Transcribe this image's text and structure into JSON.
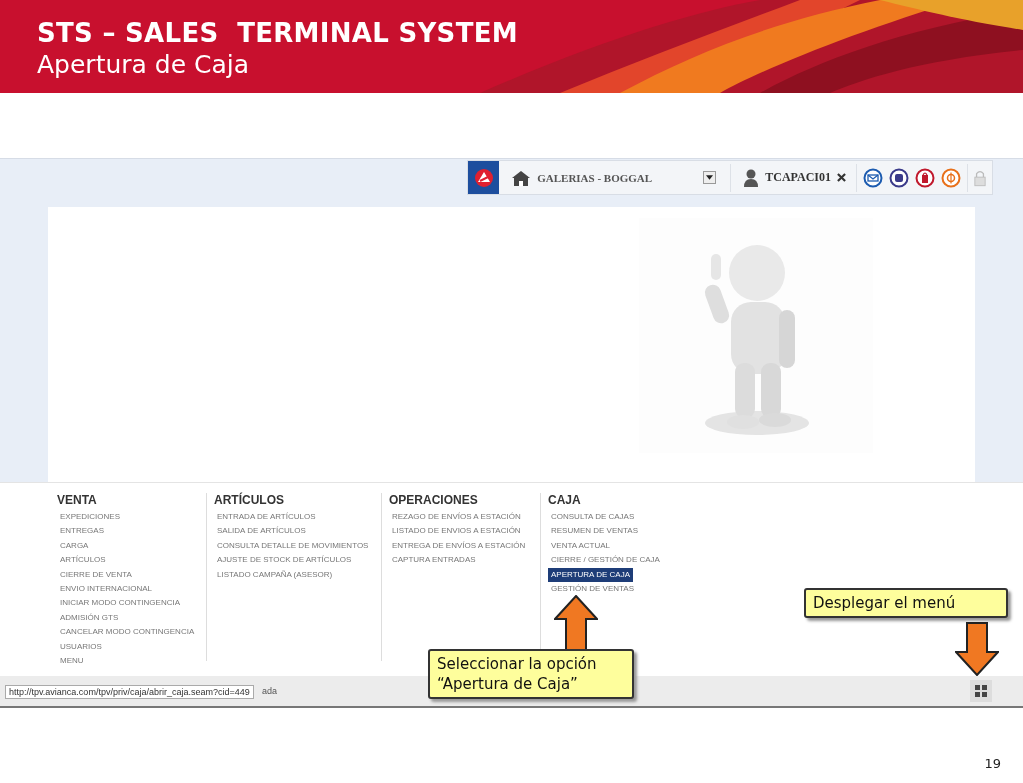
{
  "slide": {
    "title": "STS – SALES  TERMINAL SYSTEM",
    "subtitle": "Apertura de Caja",
    "page_number": "19"
  },
  "toolbar": {
    "store": "GALERIAS - BOGGAL",
    "user": "TCAPACI01"
  },
  "menu": [
    {
      "heading": "VENTA",
      "items": [
        {
          "label": "EXPEDICIONES",
          "selected": false
        },
        {
          "label": "ENTREGAS",
          "selected": false
        },
        {
          "label": "CARGA",
          "selected": false
        },
        {
          "label": "ARTÍCULOS",
          "selected": false
        },
        {
          "label": "CIERRE DE VENTA",
          "selected": false
        },
        {
          "label": "ENVIO INTERNACIONAL",
          "selected": false
        },
        {
          "label": "INICIAR MODO CONTINGENCIA",
          "selected": false
        },
        {
          "label": "ADMISIÓN GTS",
          "selected": false
        },
        {
          "label": "CANCELAR MODO CONTINGENCIA",
          "selected": false
        },
        {
          "label": "USUARIOS",
          "selected": false
        },
        {
          "label": "MENU",
          "selected": false
        }
      ]
    },
    {
      "heading": "ARTÍCULOS",
      "items": [
        {
          "label": "ENTRADA DE ARTÍCULOS",
          "selected": false
        },
        {
          "label": "SALIDA DE ARTÍCULOS",
          "selected": false
        },
        {
          "label": "CONSULTA DETALLE DE MOVIMIENTOS",
          "selected": false
        },
        {
          "label": "AJUSTE DE STOCK DE ARTÍCULOS",
          "selected": false
        },
        {
          "label": "LISTADO CAMPAÑA (ASESOR)",
          "selected": false
        }
      ]
    },
    {
      "heading": "OPERACIONES",
      "items": [
        {
          "label": "REZAGO DE ENVÍOS A ESTACIÓN",
          "selected": false
        },
        {
          "label": "LISTADO DE ENVIOS A ESTACIÓN",
          "selected": false
        },
        {
          "label": "ENTREGA DE ENVÍOS A ESTACIÓN",
          "selected": false
        },
        {
          "label": "CAPTURA ENTRADAS",
          "selected": false
        }
      ]
    },
    {
      "heading": "CAJA",
      "items": [
        {
          "label": "CONSULTA DE CAJAS",
          "selected": false
        },
        {
          "label": "RESUMEN DE VENTAS",
          "selected": false
        },
        {
          "label": "VENTA ACTUAL",
          "selected": false
        },
        {
          "label": "CIERRE / GESTIÓN DE CAJA",
          "selected": false
        },
        {
          "label": "APERTURA DE CAJA",
          "selected": true
        },
        {
          "label": "GESTIÓN DE VENTAS",
          "selected": false
        }
      ]
    }
  ],
  "status_bar": {
    "tooltip": "http://tpv.avianca.com/tpv/priv/caja/abrir_caja.seam?cid=449",
    "text": "ada"
  },
  "callouts": [
    {
      "kind": "select",
      "text": "Seleccionar la opción\n“Apertura de Caja”"
    },
    {
      "kind": "expand",
      "text": "Desplegar el menú"
    }
  ]
}
